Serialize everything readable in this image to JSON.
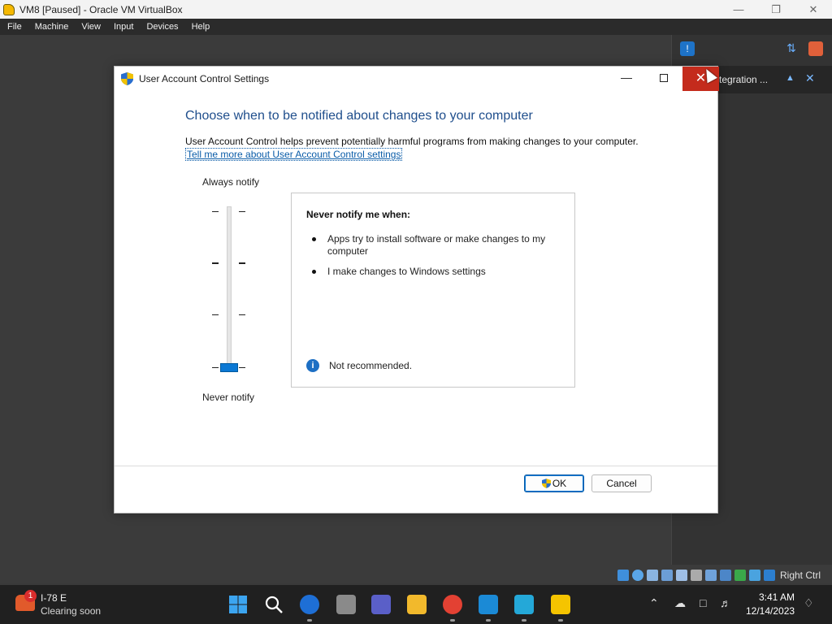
{
  "host": {
    "title": "VM8 [Paused] - Oracle VM VirtualBox",
    "menu": [
      "File",
      "Machine",
      "View",
      "Input",
      "Devices",
      "Help"
    ],
    "status_right": "Right Ctrl"
  },
  "side_panel": {
    "card_text": "tegration ..."
  },
  "dialog": {
    "title": "User Account Control Settings",
    "heading": "Choose when to be notified about changes to your computer",
    "description": "User Account Control helps prevent potentially harmful programs from making changes to your computer.",
    "link": "Tell me more about User Account Control settings",
    "slider": {
      "top_label": "Always notify",
      "bottom_label": "Never notify",
      "levels": 4,
      "selected_level": 1
    },
    "info": {
      "header": "Never notify me when:",
      "bullets": [
        "Apps try to install software or make changes to my computer",
        "I make changes to Windows settings"
      ],
      "note": "Not recommended."
    },
    "buttons": {
      "ok": "OK",
      "cancel": "Cancel"
    }
  },
  "taskbar": {
    "weather_line1": "I-78 E",
    "weather_line2": "Clearing soon",
    "badge_count": "1",
    "time": "3:41 AM",
    "date": "12/14/2023"
  },
  "colors": {
    "accent": "#0a78d4",
    "close_red": "#c42b1c",
    "heading_blue": "#1f4e8c",
    "taskbar": "#202020"
  }
}
